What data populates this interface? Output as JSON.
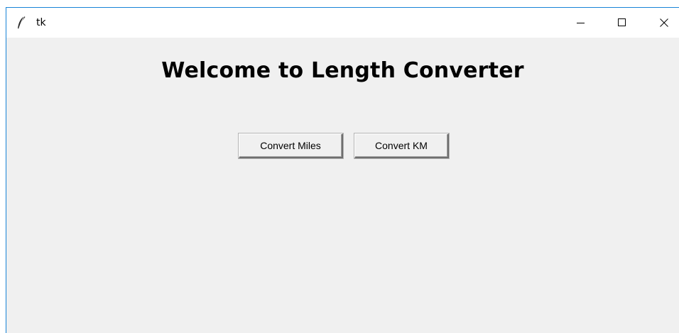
{
  "window": {
    "title": "tk",
    "controls": {
      "minimize_icon": "minimize-icon",
      "maximize_icon": "maximize-icon",
      "close_icon": "close-icon"
    },
    "accent_color": "#1883d7"
  },
  "main": {
    "heading": "Welcome to Length Converter",
    "buttons": [
      {
        "label": "Convert Miles"
      },
      {
        "label": "Convert KM"
      }
    ],
    "background_color": "#f0f0f0"
  }
}
